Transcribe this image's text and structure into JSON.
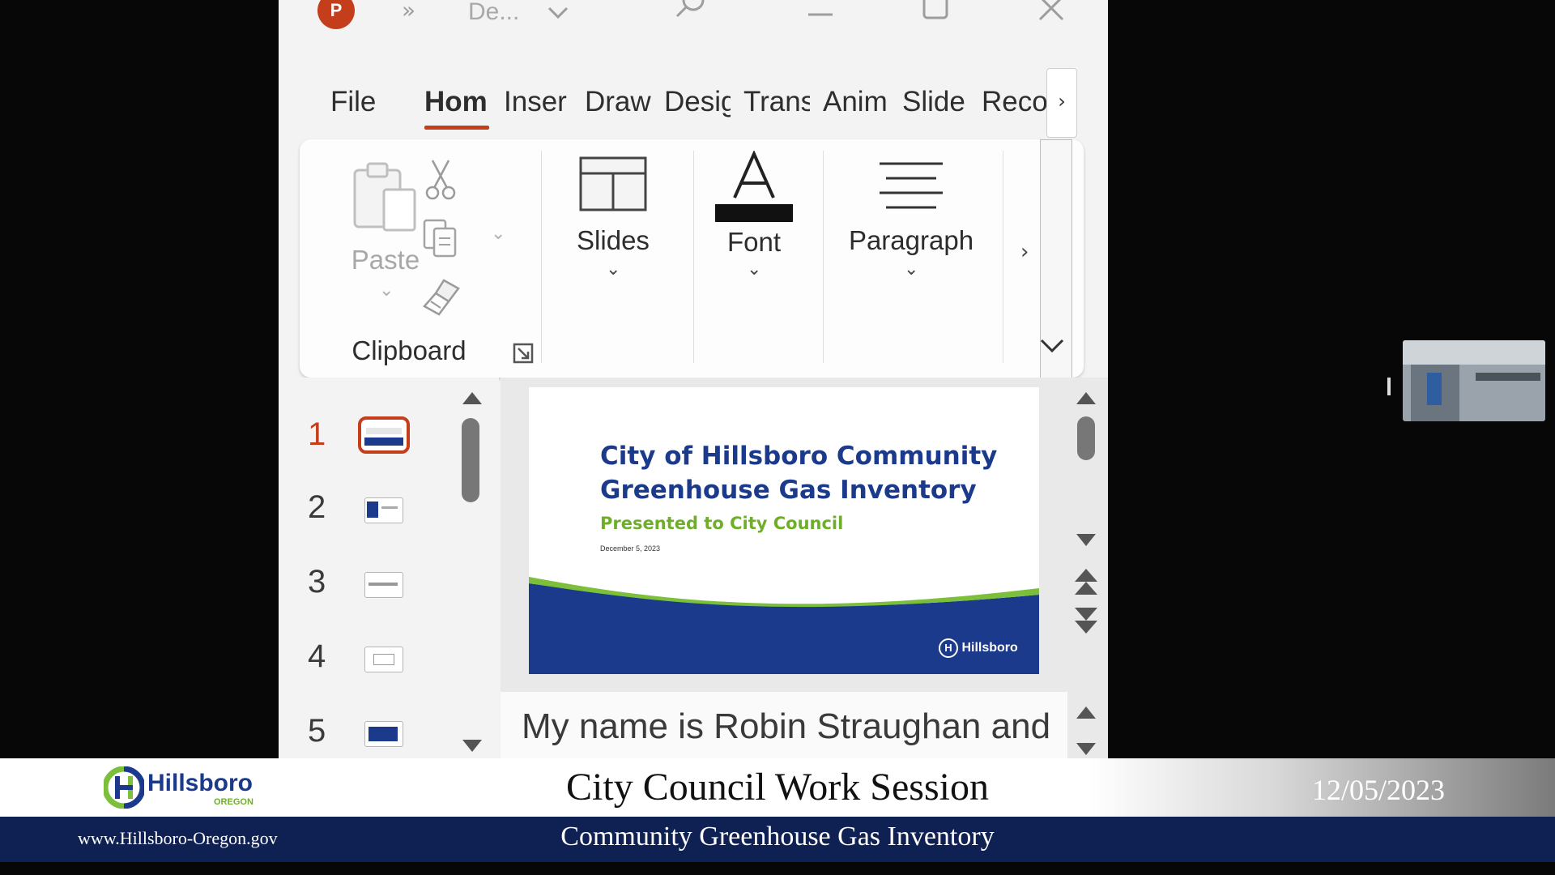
{
  "app": {
    "title_fragment": "De...",
    "icon_letter": "P"
  },
  "tabs": [
    {
      "label": "File"
    },
    {
      "label": "Hom"
    },
    {
      "label": "Inser"
    },
    {
      "label": "Draw"
    },
    {
      "label": "Desig"
    },
    {
      "label": "Trans"
    },
    {
      "label": "Anim"
    },
    {
      "label": "Slide"
    },
    {
      "label": "Reco"
    }
  ],
  "ribbon": {
    "paste_label": "Paste",
    "clipboard_label": "Clipboard",
    "slides_label": "Slides",
    "font_label": "Font",
    "paragraph_label": "Paragraph"
  },
  "thumbnails": [
    "1",
    "2",
    "3",
    "4",
    "5"
  ],
  "slide": {
    "title_line1": "City of Hillsboro Community",
    "title_line2": "Greenhouse Gas Inventory",
    "subtitle": "Presented to City Council",
    "date": "December 5, 2023",
    "logo_text": "Hillsboro"
  },
  "notes": {
    "text": "My name is Robin Straughan and"
  },
  "broadcast": {
    "logo_name": "Hillsboro",
    "logo_sub": "OREGON",
    "title": "City Council Work Session",
    "date": "12/05/2023",
    "website": "www.Hillsboro-Oregon.gov",
    "subtitle": "Community Greenhouse Gas Inventory"
  },
  "colors": {
    "accent": "#c43e1c",
    "slide_title": "#1b3a8c",
    "slide_subtitle": "#6fae2a",
    "banner_navy": "#0f2152"
  }
}
